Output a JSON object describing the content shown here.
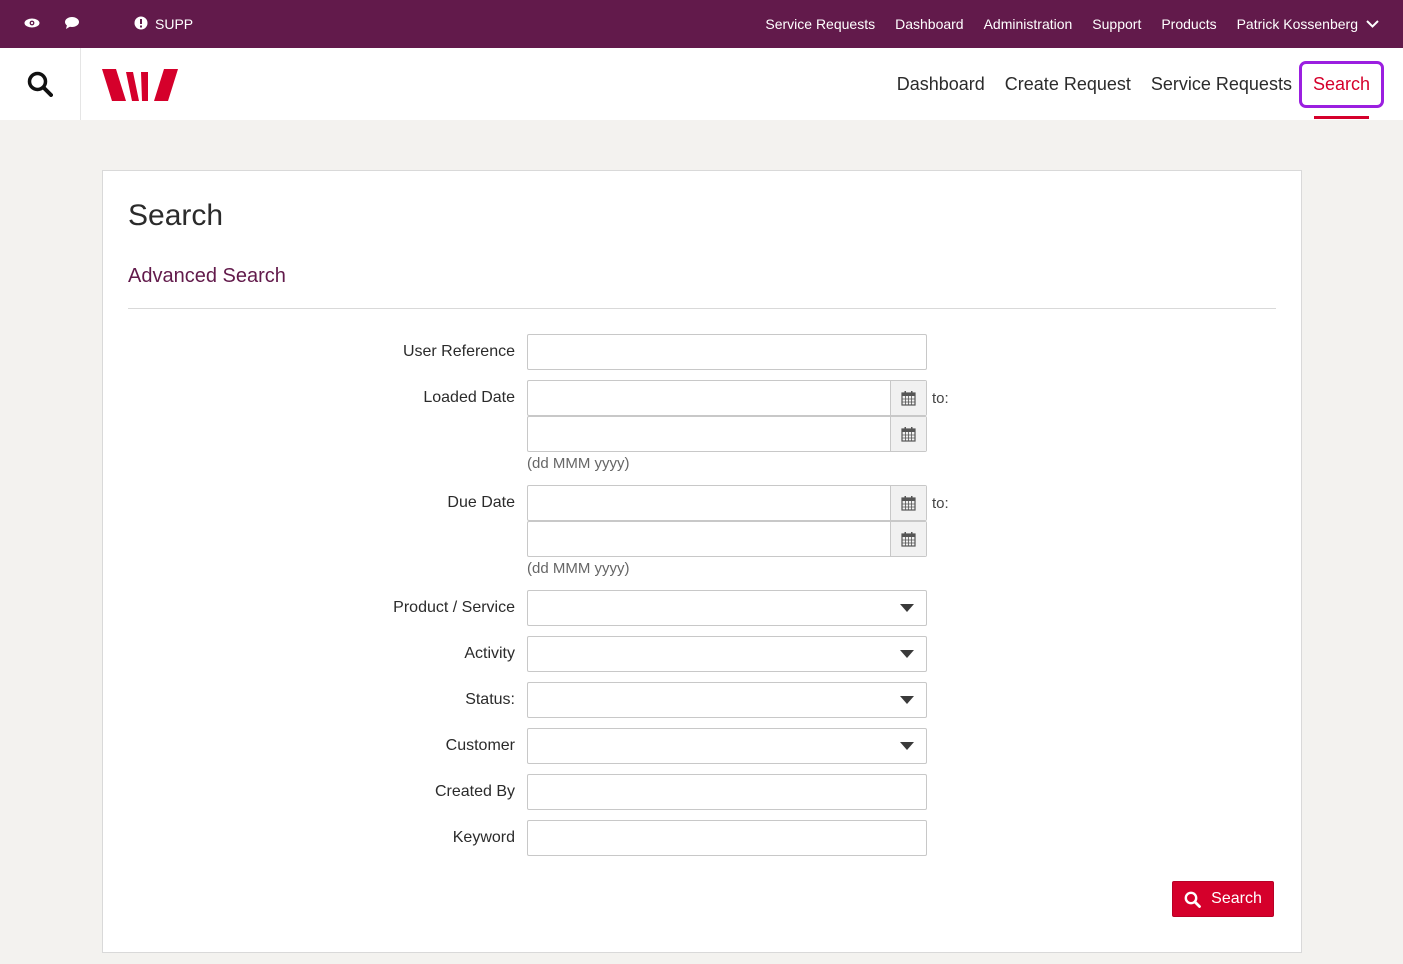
{
  "topbar": {
    "context_label": "SUPP",
    "nav": [
      "Service Requests",
      "Dashboard",
      "Administration",
      "Support",
      "Products"
    ],
    "user_name": "Patrick Kossenberg"
  },
  "header": {
    "nav": [
      "Dashboard",
      "Create Request",
      "Service Requests"
    ],
    "active_nav": "Search"
  },
  "page": {
    "title": "Search",
    "section_title": "Advanced Search"
  },
  "form": {
    "user_reference_label": "User Reference",
    "loaded_date_label": "Loaded Date",
    "due_date_label": "Due Date",
    "to_label": "to:",
    "date_hint": "(dd MMM yyyy)",
    "product_service_label": "Product / Service",
    "activity_label": "Activity",
    "status_label": "Status:",
    "customer_label": "Customer",
    "created_by_label": "Created By",
    "keyword_label": "Keyword",
    "submit_label": "Search"
  },
  "colors": {
    "topbar": "#621a4b",
    "accent": "#d5002b",
    "highlight": "#9b1fe0",
    "heading": "#621a4b"
  },
  "icons": [
    "eye-icon",
    "chat-icon",
    "alert-icon",
    "chevron-down-icon",
    "search-icon",
    "westpac-logo",
    "calendar-icon",
    "caret-down-icon"
  ]
}
